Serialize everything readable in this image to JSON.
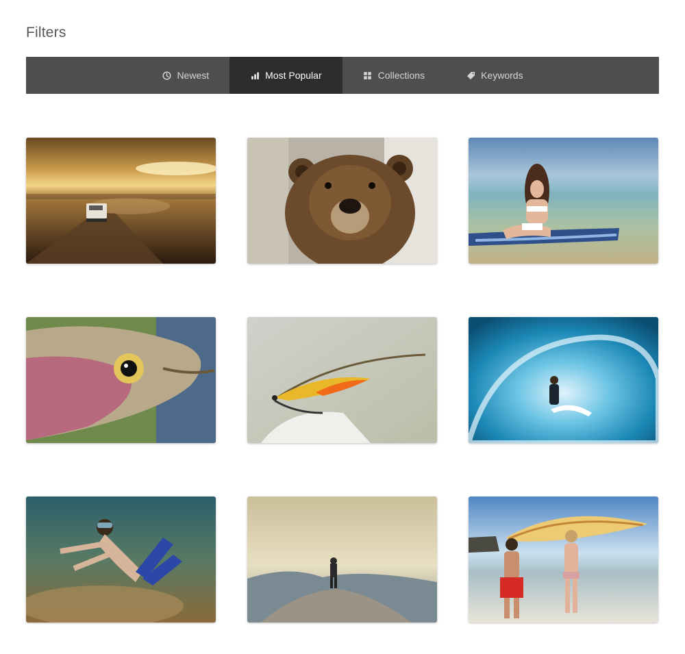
{
  "page": {
    "title": "Filters"
  },
  "filters": {
    "active": "Most Popular",
    "tabs": [
      {
        "label": "Newest",
        "icon": "clock-icon"
      },
      {
        "label": "Most Popular",
        "icon": "bar-chart-icon"
      },
      {
        "label": "Collections",
        "icon": "grid-icon"
      },
      {
        "label": "Keywords",
        "icon": "tag-icon"
      }
    ]
  },
  "gallery": {
    "photos": [
      {
        "subject": "truck-on-desert-road-at-sunset"
      },
      {
        "subject": "brown-bear-face"
      },
      {
        "subject": "woman-on-surfboard-at-shore"
      },
      {
        "subject": "trout-head-closeup"
      },
      {
        "subject": "fishing-fly-lure"
      },
      {
        "subject": "surfer-in-wave-tube"
      },
      {
        "subject": "snorkeler-underwater"
      },
      {
        "subject": "hiker-on-mountain-summit"
      },
      {
        "subject": "couple-carrying-surfboard-at-beach"
      }
    ]
  },
  "colors": {
    "filter_bar": "#4e4e4e",
    "filter_active": "#2d2d2d"
  }
}
